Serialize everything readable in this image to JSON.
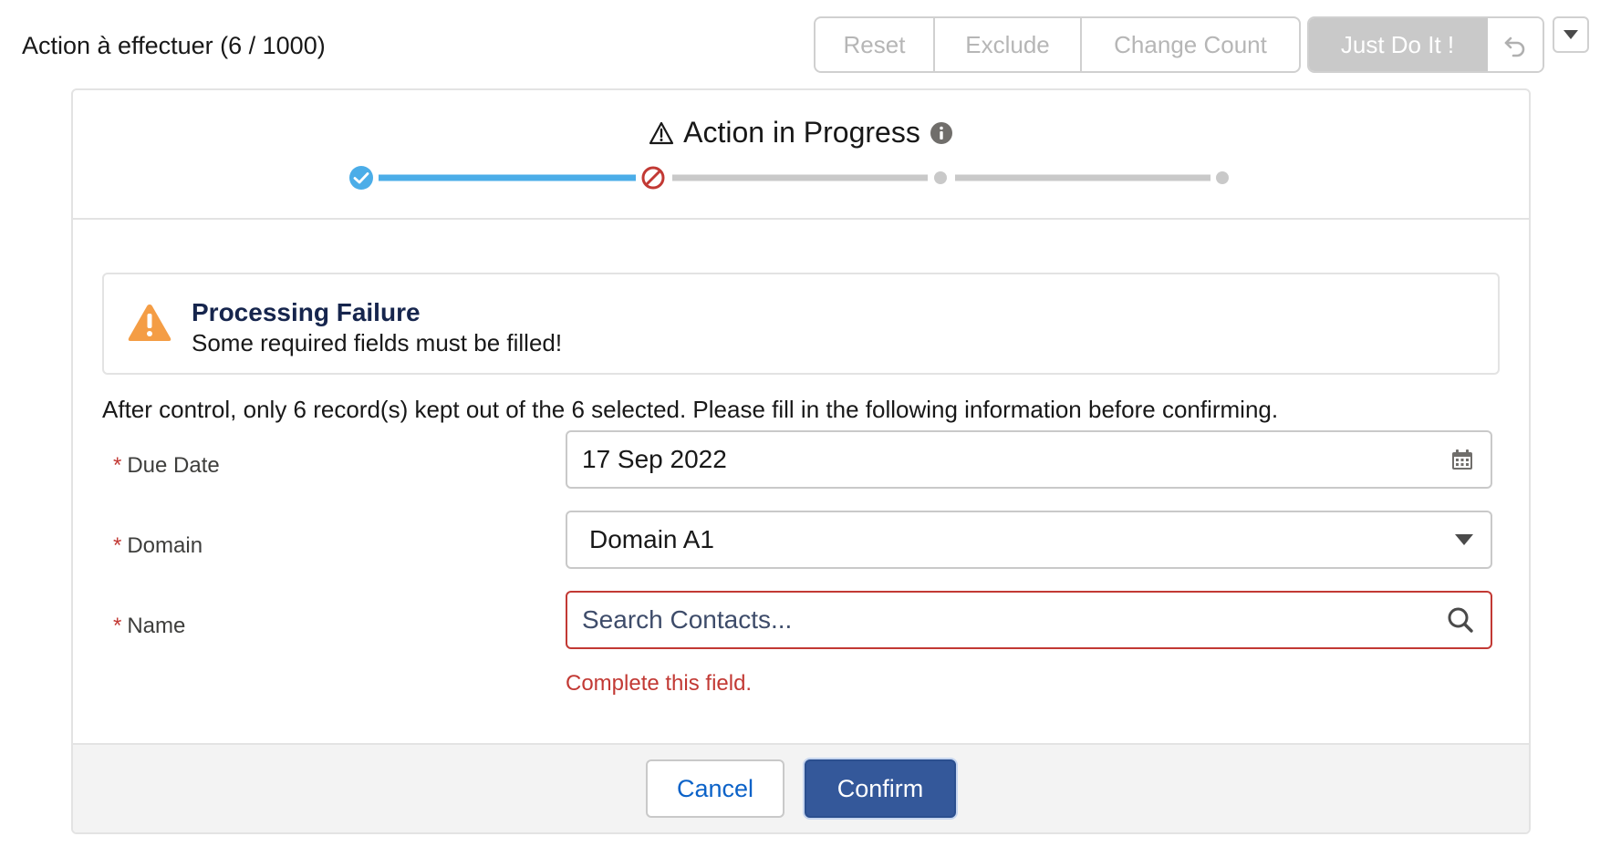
{
  "header": {
    "title": "Action à effectuer (6 / 1000)",
    "buttons": {
      "reset": "Reset",
      "exclude": "Exclude",
      "change_count": "Change Count",
      "just_do_it": "Just Do It !"
    },
    "icons": {
      "undo": "undo-icon",
      "menu": "chevron-down-icon"
    }
  },
  "card": {
    "title": "Action in Progress",
    "title_icons": {
      "leading": "warning-icon",
      "trailing": "info-icon"
    },
    "progress": {
      "steps": [
        "complete",
        "error",
        "pending",
        "pending"
      ],
      "colors": {
        "complete": "#4bade8",
        "error": "#c23934",
        "pending": "#c9c9c9"
      }
    },
    "alert": {
      "icon": "warning-icon",
      "title": "Processing Failure",
      "message": "Some required fields must be filled!",
      "color": "#f49d45"
    },
    "info_text": "After control, only 6 record(s) kept out of the 6 selected. Please fill in the following information before confirming.",
    "fields": {
      "due_date": {
        "label": "Due Date",
        "required_mark": "*",
        "value": "17 Sep 2022",
        "icon": "calendar-icon"
      },
      "domain": {
        "label": "Domain",
        "required_mark": "*",
        "value": "Domain A1",
        "icon": "chevron-down-icon"
      },
      "name": {
        "label": "Name",
        "required_mark": "*",
        "placeholder": "Search Contacts...",
        "icon": "search-icon",
        "error": "Complete this field."
      }
    },
    "footer": {
      "cancel": "Cancel",
      "confirm": "Confirm"
    }
  }
}
